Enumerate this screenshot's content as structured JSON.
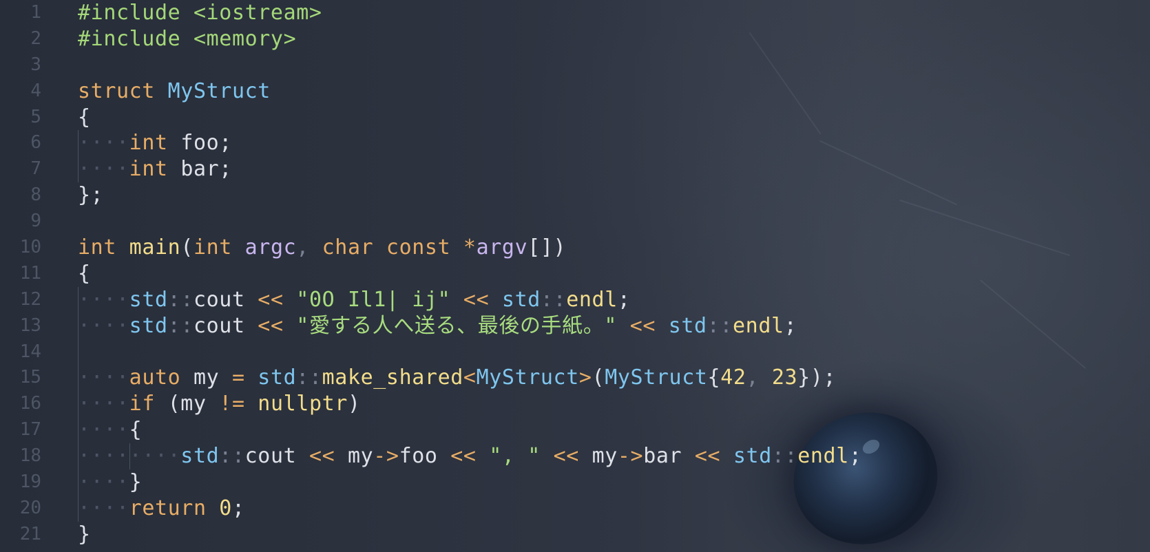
{
  "editor": {
    "line_numbers": [
      "1",
      "2",
      "3",
      "4",
      "5",
      "6",
      "7",
      "8",
      "9",
      "10",
      "11",
      "12",
      "13",
      "14",
      "15",
      "16",
      "17",
      "18",
      "19",
      "20",
      "21"
    ],
    "lines": [
      [
        {
          "c": "pp",
          "t": "#include <iostream>"
        }
      ],
      [
        {
          "c": "pp",
          "t": "#include <memory>"
        }
      ],
      [],
      [
        {
          "c": "kw",
          "t": "struct "
        },
        {
          "c": "ty",
          "t": "MyStruct"
        }
      ],
      [
        {
          "c": "pu",
          "t": "{"
        }
      ],
      [
        {
          "c": "ws",
          "t": "····"
        },
        {
          "c": "kw",
          "t": "int"
        },
        {
          "c": "pu",
          "t": " foo;"
        }
      ],
      [
        {
          "c": "ws",
          "t": "····"
        },
        {
          "c": "kw",
          "t": "int"
        },
        {
          "c": "pu",
          "t": " bar;"
        }
      ],
      [
        {
          "c": "pu",
          "t": "};"
        }
      ],
      [],
      [
        {
          "c": "kw",
          "t": "int "
        },
        {
          "c": "fn",
          "t": "main"
        },
        {
          "c": "pu",
          "t": "("
        },
        {
          "c": "kw",
          "t": "int "
        },
        {
          "c": "pa",
          "t": "argc"
        },
        {
          "c": "co",
          "t": ", "
        },
        {
          "c": "kw",
          "t": "char const "
        },
        {
          "c": "op",
          "t": "*"
        },
        {
          "c": "pa",
          "t": "argv"
        },
        {
          "c": "pu",
          "t": "[])"
        }
      ],
      [
        {
          "c": "pu",
          "t": "{"
        }
      ],
      [
        {
          "c": "ws",
          "t": "····"
        },
        {
          "c": "ns",
          "t": "std"
        },
        {
          "c": "co",
          "t": "::"
        },
        {
          "c": "pu",
          "t": "cout "
        },
        {
          "c": "op",
          "t": "<< "
        },
        {
          "c": "st",
          "t": "\"0O Il1| ij\""
        },
        {
          "c": "op",
          "t": " << "
        },
        {
          "c": "ns",
          "t": "std"
        },
        {
          "c": "co",
          "t": "::"
        },
        {
          "c": "fn",
          "t": "endl"
        },
        {
          "c": "pu",
          "t": ";"
        }
      ],
      [
        {
          "c": "ws",
          "t": "····"
        },
        {
          "c": "ns",
          "t": "std"
        },
        {
          "c": "co",
          "t": "::"
        },
        {
          "c": "pu",
          "t": "cout "
        },
        {
          "c": "op",
          "t": "<< "
        },
        {
          "c": "st",
          "t": "\"愛する人へ送る、最後の手紙。\""
        },
        {
          "c": "op",
          "t": " << "
        },
        {
          "c": "ns",
          "t": "std"
        },
        {
          "c": "co",
          "t": "::"
        },
        {
          "c": "fn",
          "t": "endl"
        },
        {
          "c": "pu",
          "t": ";"
        }
      ],
      [],
      [
        {
          "c": "ws",
          "t": "····"
        },
        {
          "c": "kw",
          "t": "auto"
        },
        {
          "c": "pu",
          "t": " my "
        },
        {
          "c": "op",
          "t": "= "
        },
        {
          "c": "ns",
          "t": "std"
        },
        {
          "c": "co",
          "t": "::"
        },
        {
          "c": "fn",
          "t": "make_shared"
        },
        {
          "c": "op",
          "t": "<"
        },
        {
          "c": "ty",
          "t": "MyStruct"
        },
        {
          "c": "op",
          "t": ">"
        },
        {
          "c": "pu",
          "t": "("
        },
        {
          "c": "ty",
          "t": "MyStruct"
        },
        {
          "c": "pu",
          "t": "{"
        },
        {
          "c": "nu",
          "t": "42"
        },
        {
          "c": "co",
          "t": ", "
        },
        {
          "c": "nu",
          "t": "23"
        },
        {
          "c": "pu",
          "t": "});"
        }
      ],
      [
        {
          "c": "ws",
          "t": "····"
        },
        {
          "c": "kw",
          "t": "if"
        },
        {
          "c": "pu",
          "t": " (my "
        },
        {
          "c": "op",
          "t": "!= "
        },
        {
          "c": "fn",
          "t": "nullptr"
        },
        {
          "c": "pu",
          "t": ")"
        }
      ],
      [
        {
          "c": "ws",
          "t": "····"
        },
        {
          "c": "pu",
          "t": "{"
        }
      ],
      [
        {
          "c": "ws",
          "t": "········"
        },
        {
          "c": "ns",
          "t": "std"
        },
        {
          "c": "co",
          "t": "::"
        },
        {
          "c": "pu",
          "t": "cout "
        },
        {
          "c": "op",
          "t": "<< "
        },
        {
          "c": "pu",
          "t": "my"
        },
        {
          "c": "op",
          "t": "->"
        },
        {
          "c": "pu",
          "t": "foo "
        },
        {
          "c": "op",
          "t": "<< "
        },
        {
          "c": "st",
          "t": "\", \""
        },
        {
          "c": "op",
          "t": " << "
        },
        {
          "c": "pu",
          "t": "my"
        },
        {
          "c": "op",
          "t": "->"
        },
        {
          "c": "pu",
          "t": "bar "
        },
        {
          "c": "op",
          "t": "<< "
        },
        {
          "c": "ns",
          "t": "std"
        },
        {
          "c": "co",
          "t": "::"
        },
        {
          "c": "fn",
          "t": "endl"
        },
        {
          "c": "pu",
          "t": ";"
        }
      ],
      [
        {
          "c": "ws",
          "t": "····"
        },
        {
          "c": "pu",
          "t": "}"
        }
      ],
      [
        {
          "c": "ws",
          "t": "····"
        },
        {
          "c": "kw",
          "t": "return "
        },
        {
          "c": "nu",
          "t": "0"
        },
        {
          "c": "pu",
          "t": ";"
        }
      ],
      [
        {
          "c": "pu",
          "t": "}"
        }
      ]
    ],
    "indent_guides": [
      [],
      [],
      [],
      [],
      [],
      [
        "g1"
      ],
      [
        "g1"
      ],
      [],
      [],
      [],
      [],
      [
        "g1"
      ],
      [
        "g1"
      ],
      [
        "g1"
      ],
      [
        "g1"
      ],
      [
        "g1"
      ],
      [
        "g1"
      ],
      [
        "g1",
        "g2"
      ],
      [
        "g1"
      ],
      [
        "g1"
      ],
      []
    ],
    "colors": {
      "background": "#282e3a",
      "line_number": "#4e5565",
      "preprocessor": "#a5d879",
      "keyword": "#e8ad66",
      "type": "#7fc6ef",
      "function": "#f3dd8b",
      "parameter": "#c9b6ef",
      "string": "#a8dc7f"
    }
  }
}
